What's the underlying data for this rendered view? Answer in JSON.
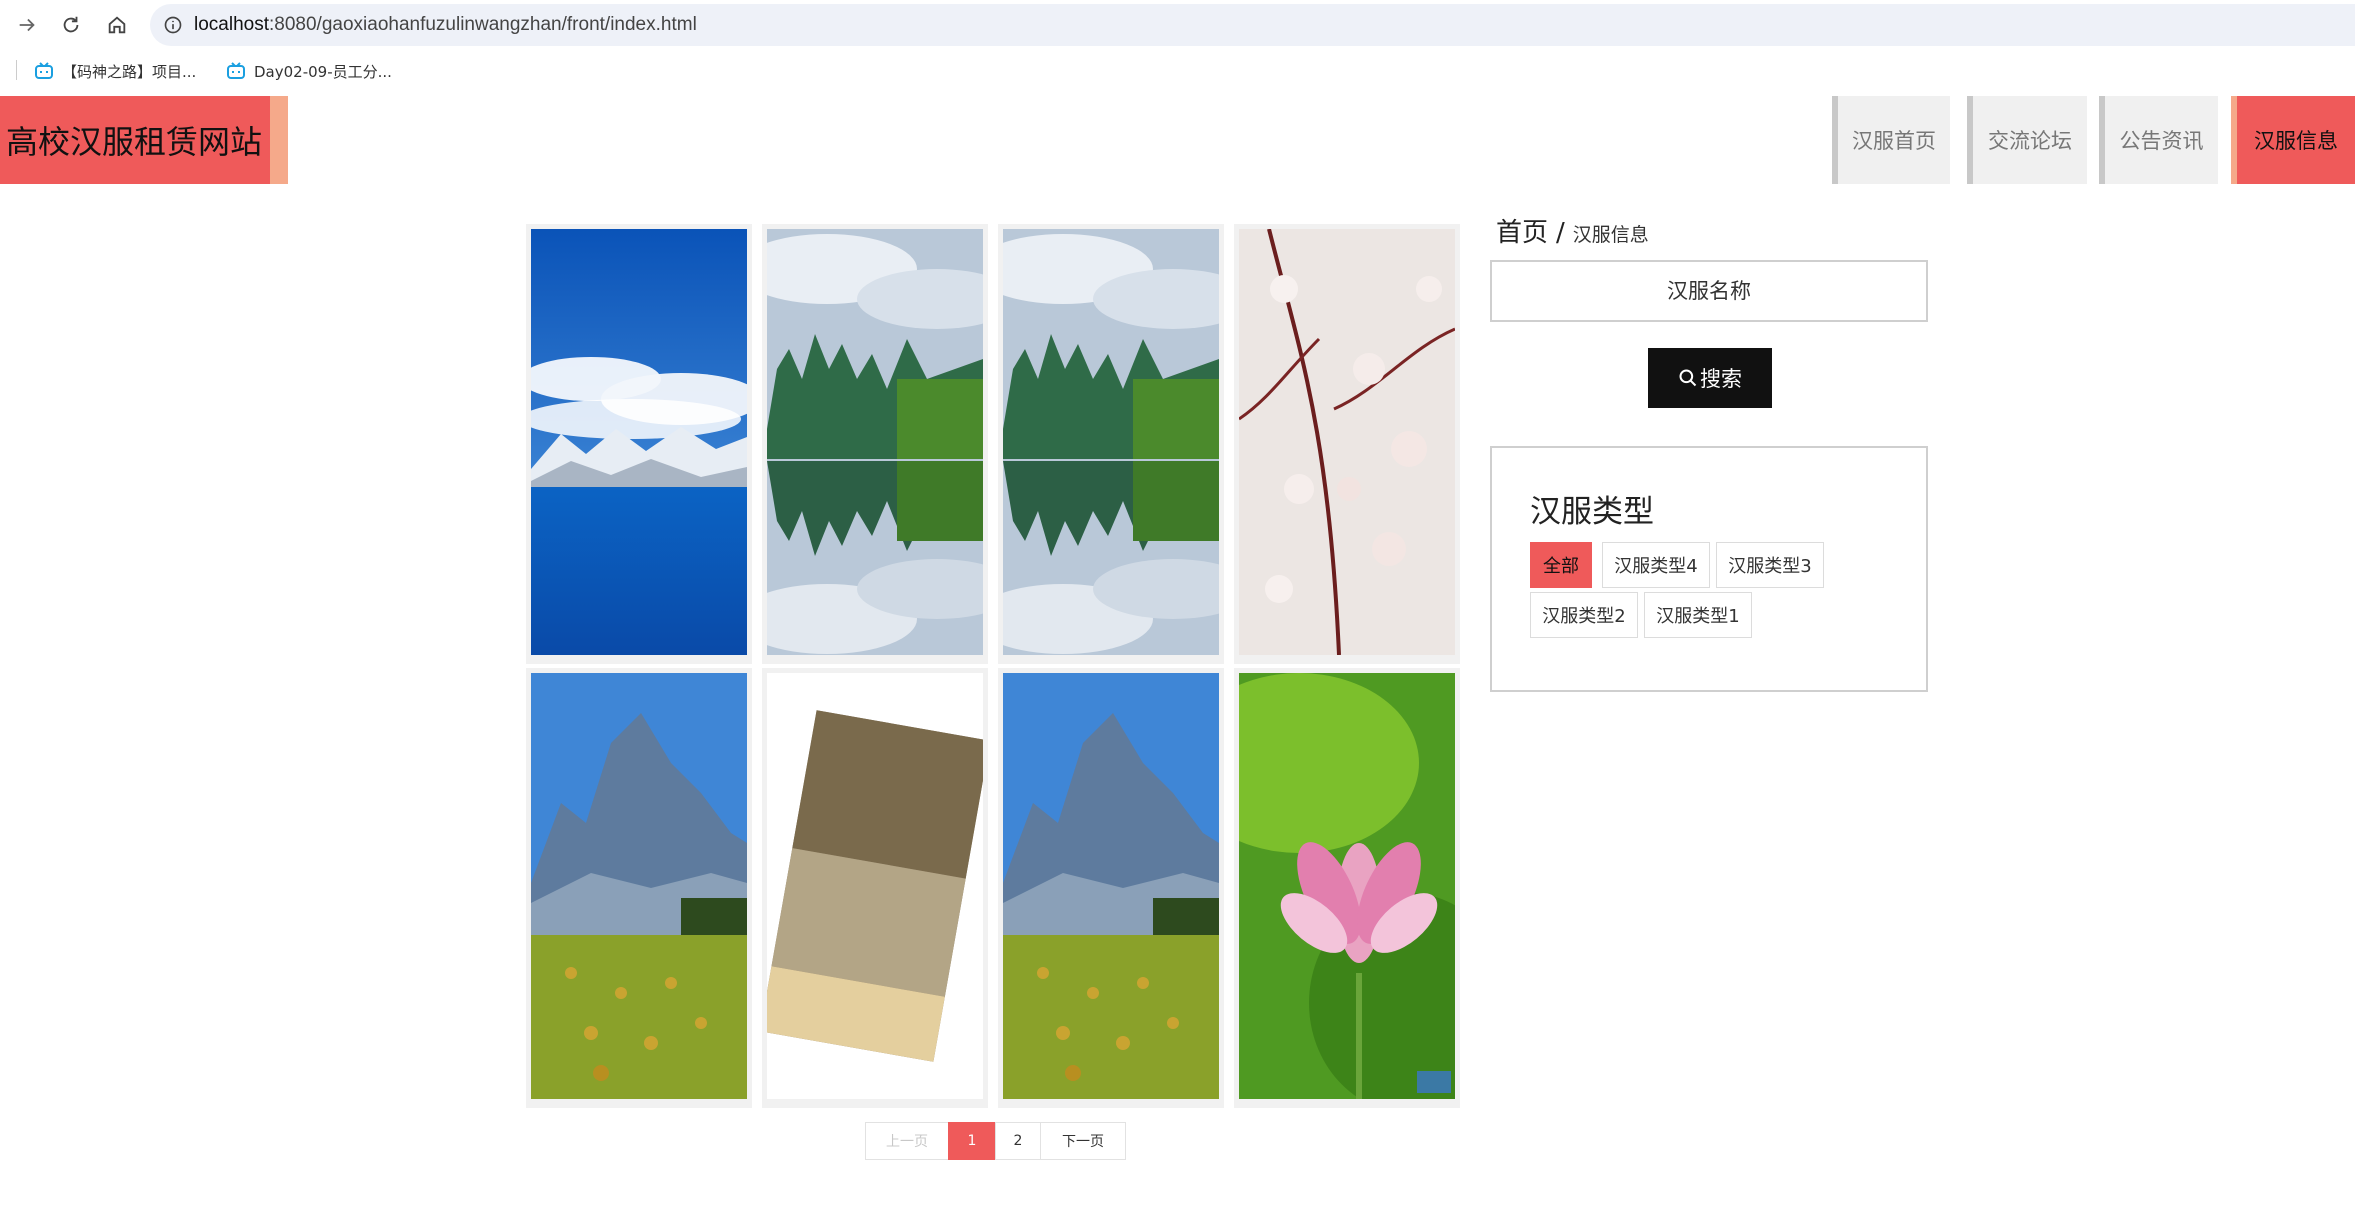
{
  "browser": {
    "url_host": "localhost",
    "url_path": ":8080/gaoxiaohanfuzulinwangzhan/front/index.html",
    "bookmarks": [
      {
        "label": "【码神之路】项目..."
      },
      {
        "label": "Day02-09-员工分..."
      }
    ]
  },
  "header": {
    "site_title": "高校汉服租赁网站",
    "nav": [
      {
        "label": "汉服首页",
        "active": false
      },
      {
        "label": "交流论坛",
        "active": false
      },
      {
        "label": "公告资讯",
        "active": false
      },
      {
        "label": "汉服信息",
        "active": true
      }
    ]
  },
  "gallery": {
    "items": [
      {
        "image": "lake-snow-mountain"
      },
      {
        "image": "karst-river-reflection"
      },
      {
        "image": "karst-river-reflection"
      },
      {
        "image": "cherry-blossom-branch"
      },
      {
        "image": "mountain-hay-field"
      },
      {
        "image": "tilted-landscape-reflection"
      },
      {
        "image": "mountain-hay-field"
      },
      {
        "image": "pink-lotus"
      }
    ]
  },
  "pagination": {
    "prev_label": "上一页",
    "pages": [
      "1",
      "2"
    ],
    "current_page": "1",
    "next_label": "下一页"
  },
  "sidebar": {
    "breadcrumb_home": "首页",
    "breadcrumb_sep": "/",
    "breadcrumb_current": "汉服信息",
    "search_placeholder": "汉服名称",
    "search_label": "搜索",
    "type_title": "汉服类型",
    "types": [
      "全部",
      "汉服类型4",
      "汉服类型3",
      "汉服类型2",
      "汉服类型1"
    ],
    "active_type": "全部"
  },
  "colors": {
    "accent": "#ef5a5a",
    "accent_light": "#f5a98a",
    "search_button": "#111111"
  }
}
